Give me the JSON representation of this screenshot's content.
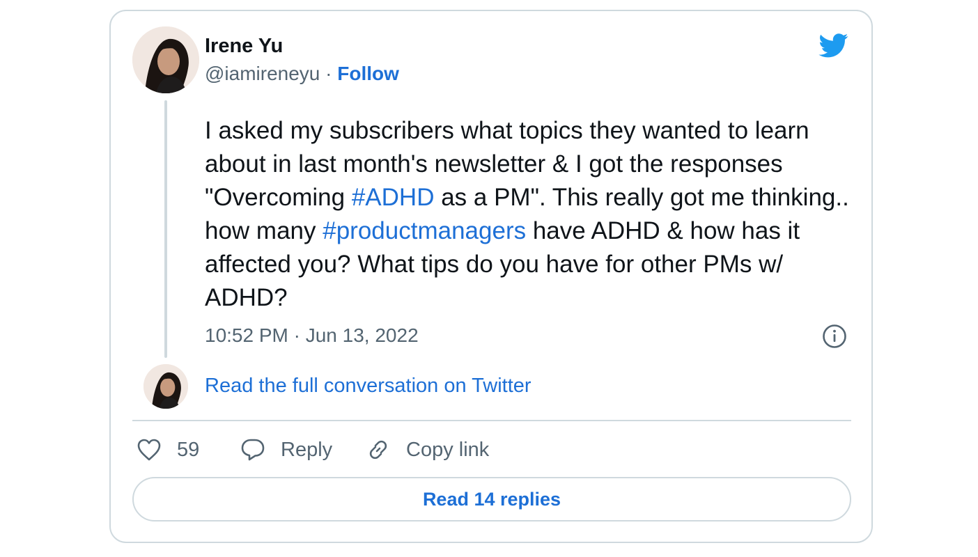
{
  "author": {
    "name": "Irene Yu",
    "handle": "@iamireneyu",
    "separator": " · ",
    "follow_label": "Follow"
  },
  "tweet": {
    "segments": [
      {
        "text": "I asked my subscribers what topics they wanted to learn about in last month's newsletter & I got the responses \"Overcoming ",
        "hashtag": false
      },
      {
        "text": "#ADHD",
        "hashtag": true
      },
      {
        "text": " as a PM\". This really got me thinking.. how many ",
        "hashtag": false
      },
      {
        "text": "#productmanagers",
        "hashtag": true
      },
      {
        "text": " have ADHD & how has it affected you? What tips do you have for other PMs w/ ADHD?",
        "hashtag": false
      }
    ],
    "timestamp": "10:52 PM · Jun 13, 2022"
  },
  "conversation_link": "Read the full conversation on Twitter",
  "actions": {
    "likes_count": "59",
    "reply_label": "Reply",
    "copy_link_label": "Copy link"
  },
  "read_replies_label": "Read 14 replies",
  "icons": {
    "brand": "twitter-bird-icon",
    "info": "info-icon",
    "like": "heart-icon",
    "reply": "speech-bubble-icon",
    "copy": "link-icon"
  },
  "colors": {
    "link_blue": "#1d6fd6",
    "twitter_blue": "#1d9bf0",
    "muted_gray": "#536471",
    "border": "#cfd9de"
  }
}
